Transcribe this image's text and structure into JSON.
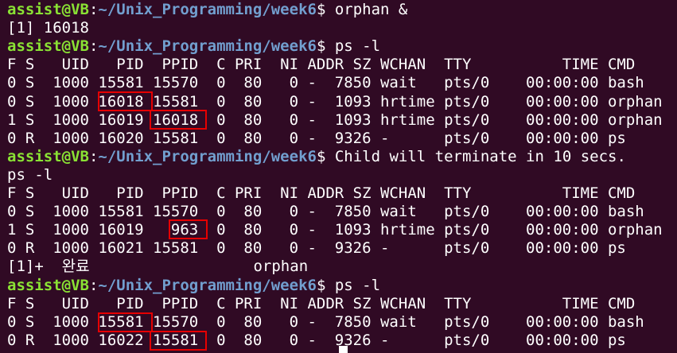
{
  "colors": {
    "background": "#300a24",
    "prompt_user": "#8ae234",
    "prompt_path": "#729fcf",
    "text": "#ffffff",
    "highlight_box": "#e60000"
  },
  "prompt": {
    "user_host": "assist@VB",
    "separator": ":",
    "path": "~/Unix_Programming/week6",
    "symbol": "$ "
  },
  "lines": [
    {
      "type": "prompt",
      "cmd": "orphan &"
    },
    {
      "type": "text",
      "text": "[1] 16018"
    },
    {
      "type": "prompt",
      "cmd": "ps -l"
    },
    {
      "type": "text",
      "text": "F S   UID   PID  PPID  C PRI  NI ADDR SZ WCHAN  TTY          TIME CMD"
    },
    {
      "type": "text",
      "text": "0 S  1000 15581 15570  0  80   0 -  7850 wait   pts/0    00:00:00 bash"
    },
    {
      "type": "text",
      "text": "0 S  1000 16018 15581  0  80   0 -  1093 hrtime pts/0    00:00:00 orphan"
    },
    {
      "type": "text",
      "text": "1 S  1000 16019 16018  0  80   0 -  1093 hrtime pts/0    00:00:00 orphan"
    },
    {
      "type": "text",
      "text": "0 R  1000 16020 15581  0  80   0 -  9326 -      pts/0    00:00:00 ps"
    },
    {
      "type": "prompt",
      "cmd": "Child will terminate in 10 secs."
    },
    {
      "type": "text",
      "text": "ps -l"
    },
    {
      "type": "text",
      "text": "F S   UID   PID  PPID  C PRI  NI ADDR SZ WCHAN  TTY          TIME CMD"
    },
    {
      "type": "text",
      "text": "0 S  1000 15581 15570  0  80   0 -  7850 wait   pts/0    00:00:00 bash"
    },
    {
      "type": "text",
      "text": "1 S  1000 16019   963  0  80   0 -  1093 hrtime pts/0    00:00:00 orphan"
    },
    {
      "type": "text",
      "text": "0 R  1000 16021 15581  0  80   0 -  9326 -      pts/0    00:00:00 ps"
    },
    {
      "type": "text",
      "text": "[1]+  완료                  orphan"
    },
    {
      "type": "prompt",
      "cmd": "ps -l"
    },
    {
      "type": "text",
      "text": "F S   UID   PID  PPID  C PRI  NI ADDR SZ WCHAN  TTY          TIME CMD"
    },
    {
      "type": "text",
      "text": "0 S  1000 15581 15570  0  80   0 -  7850 wait   pts/0    00:00:00 bash"
    },
    {
      "type": "text",
      "text": "0 R  1000 16022 15581  0  80   0 -  9326 -      pts/0    00:00:00 ps"
    }
  ]
}
